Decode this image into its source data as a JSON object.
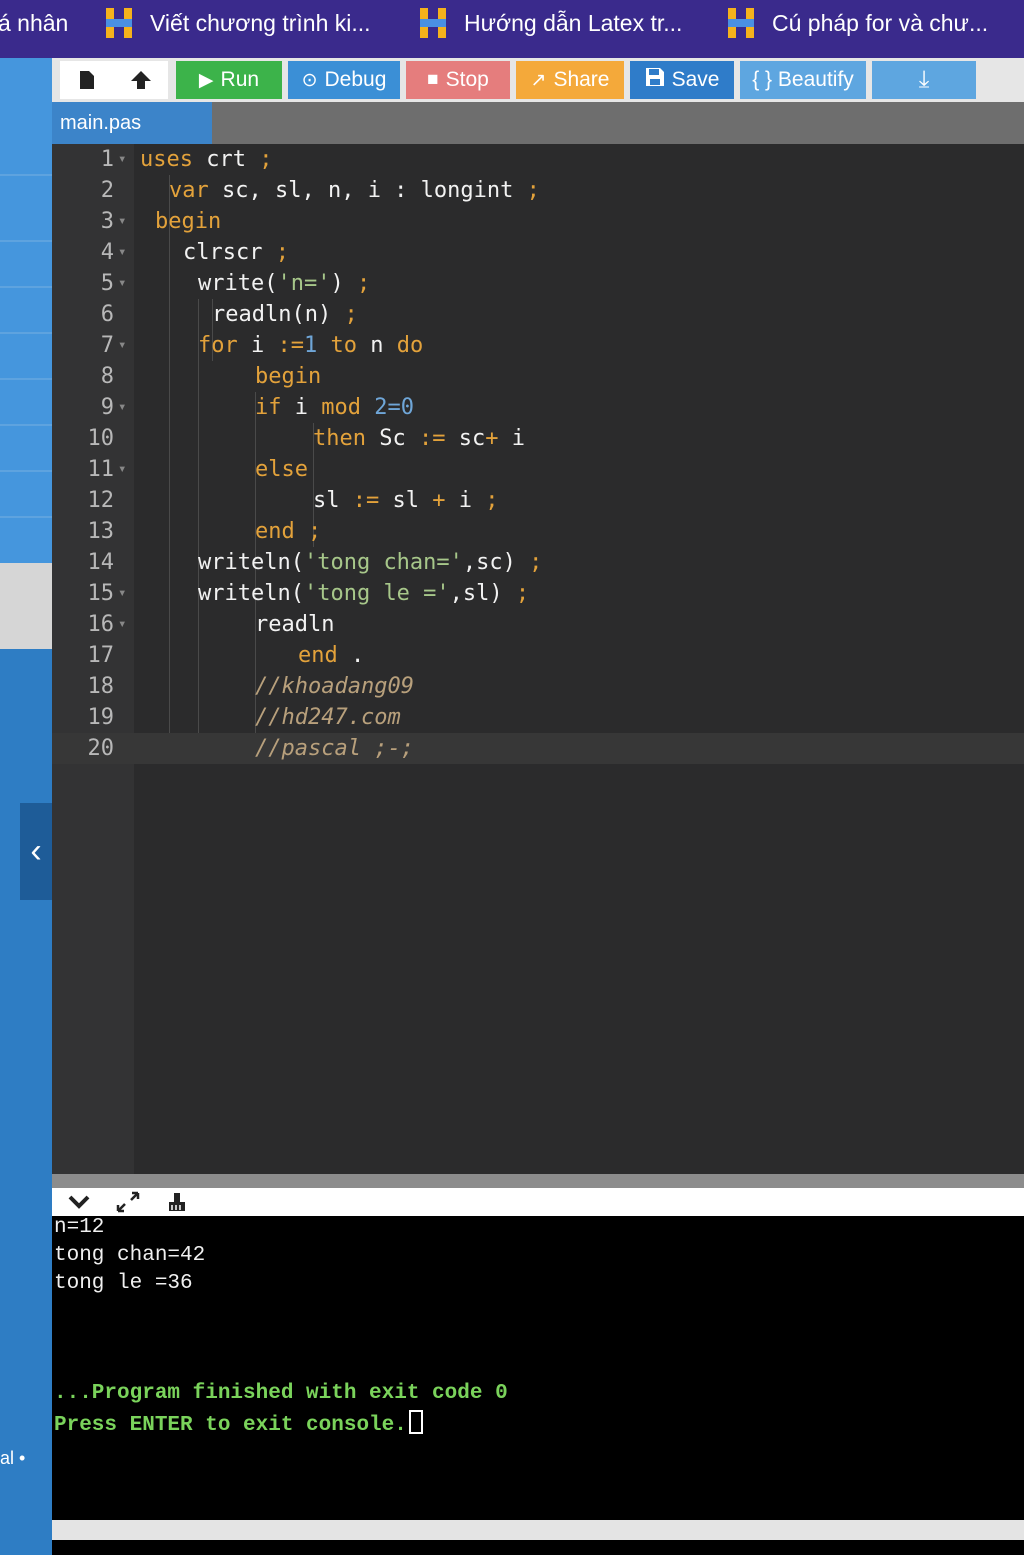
{
  "bookmarks": [
    {
      "label": "á nhân",
      "icon": ""
    },
    {
      "label": "Viết chương trình ki...",
      "icon": "hoc247-logo-icon"
    },
    {
      "label": "Hướng dẫn Latex tr...",
      "icon": "hoc247-logo-icon"
    },
    {
      "label": "Cú pháp for và chư...",
      "icon": "hoc247-logo-icon"
    }
  ],
  "toolbar": {
    "new_icon": "file-icon",
    "upload_icon": "upload-icon",
    "run": {
      "label": "Run",
      "icon": "▶",
      "color": "#3cb34a"
    },
    "debug": {
      "label": "Debug",
      "icon": "⊙",
      "color": "#3b8fd6"
    },
    "stop": {
      "label": "Stop",
      "icon": "■",
      "color": "#e57d7d"
    },
    "share": {
      "label": "Share",
      "icon": "↗",
      "color": "#f4a93a"
    },
    "save": {
      "label": "Save",
      "icon": "💾",
      "color": "#2f7cc9"
    },
    "beautify": {
      "label": "{ } Beautify",
      "color": "#5ea6e0"
    },
    "download_icon": "⤓"
  },
  "file_tab": "main.pas",
  "editor": {
    "active_line": 20,
    "lines": [
      {
        "n": "1",
        "fold": true
      },
      {
        "n": "2",
        "fold": false
      },
      {
        "n": "3",
        "fold": true
      },
      {
        "n": "4",
        "fold": true
      },
      {
        "n": "5",
        "fold": true
      },
      {
        "n": "6",
        "fold": false
      },
      {
        "n": "7",
        "fold": true
      },
      {
        "n": "8",
        "fold": false
      },
      {
        "n": "9",
        "fold": true
      },
      {
        "n": "10",
        "fold": false
      },
      {
        "n": "11",
        "fold": true
      },
      {
        "n": "12",
        "fold": false
      },
      {
        "n": "13",
        "fold": false
      },
      {
        "n": "14",
        "fold": false
      },
      {
        "n": "15",
        "fold": true
      },
      {
        "n": "16",
        "fold": true
      },
      {
        "n": "17",
        "fold": false
      },
      {
        "n": "18",
        "fold": false
      },
      {
        "n": "19",
        "fold": false
      },
      {
        "n": "20",
        "fold": false
      }
    ],
    "code": {
      "l1": {
        "t1": "uses",
        "t2": " crt ",
        "t3": ";"
      },
      "l2": {
        "t1": "var",
        "t2": " sc, sl, n, i : longint ",
        "t3": ";"
      },
      "l3": {
        "t1": "begin"
      },
      "l4": {
        "t1": "clrscr ",
        "t2": ";"
      },
      "l5": {
        "t1": "write(",
        "t2": "'n='",
        "t3": ") ",
        "t4": ";"
      },
      "l6": {
        "t1": "readln(n) ",
        "t2": ";"
      },
      "l7": {
        "t1": "for",
        "t2": " i ",
        "t3": ":=",
        "t4": "1",
        "t5": " to",
        "t6": " n ",
        "t7": "do"
      },
      "l8": {
        "t1": "begin"
      },
      "l9": {
        "t1": "if",
        "t2": " i ",
        "t3": "mod",
        "t4": " 2=0"
      },
      "l10": {
        "t1": "then",
        "t2": " Sc ",
        "t3": ":=",
        "t4": " sc",
        "t5": "+",
        "t6": " i"
      },
      "l11": {
        "t1": "else"
      },
      "l12": {
        "t1": "sl ",
        "t2": ":=",
        "t3": " sl ",
        "t4": "+",
        "t5": " i ",
        "t6": ";"
      },
      "l13": {
        "t1": "end",
        "t2": " ;"
      },
      "l14": {
        "t1": "writeln(",
        "t2": "'tong chan='",
        "t3": ",sc) ",
        "t4": ";"
      },
      "l15": {
        "t1": "writeln(",
        "t2": "'tong le ='",
        "t3": ",sl) ",
        "t4": ";"
      },
      "l16": {
        "t1": "readln"
      },
      "l17": {
        "t1": "end",
        "t2": " ."
      },
      "l18": {
        "t1": "//khoadang09"
      },
      "l19": {
        "t1": "//hd247.com"
      },
      "l20": {
        "t1": "//pascal ;-;"
      }
    }
  },
  "console": {
    "toolbar_icons": [
      "chevron-down-icon",
      "expand-icon",
      "clear-icon"
    ],
    "lines": [
      "n=12",
      "tong chan=42",
      "tong le =36"
    ],
    "finished": "...Program finished with exit code 0",
    "prompt": "Press ENTER to exit console."
  },
  "left_rail": {
    "footer": "al •"
  }
}
